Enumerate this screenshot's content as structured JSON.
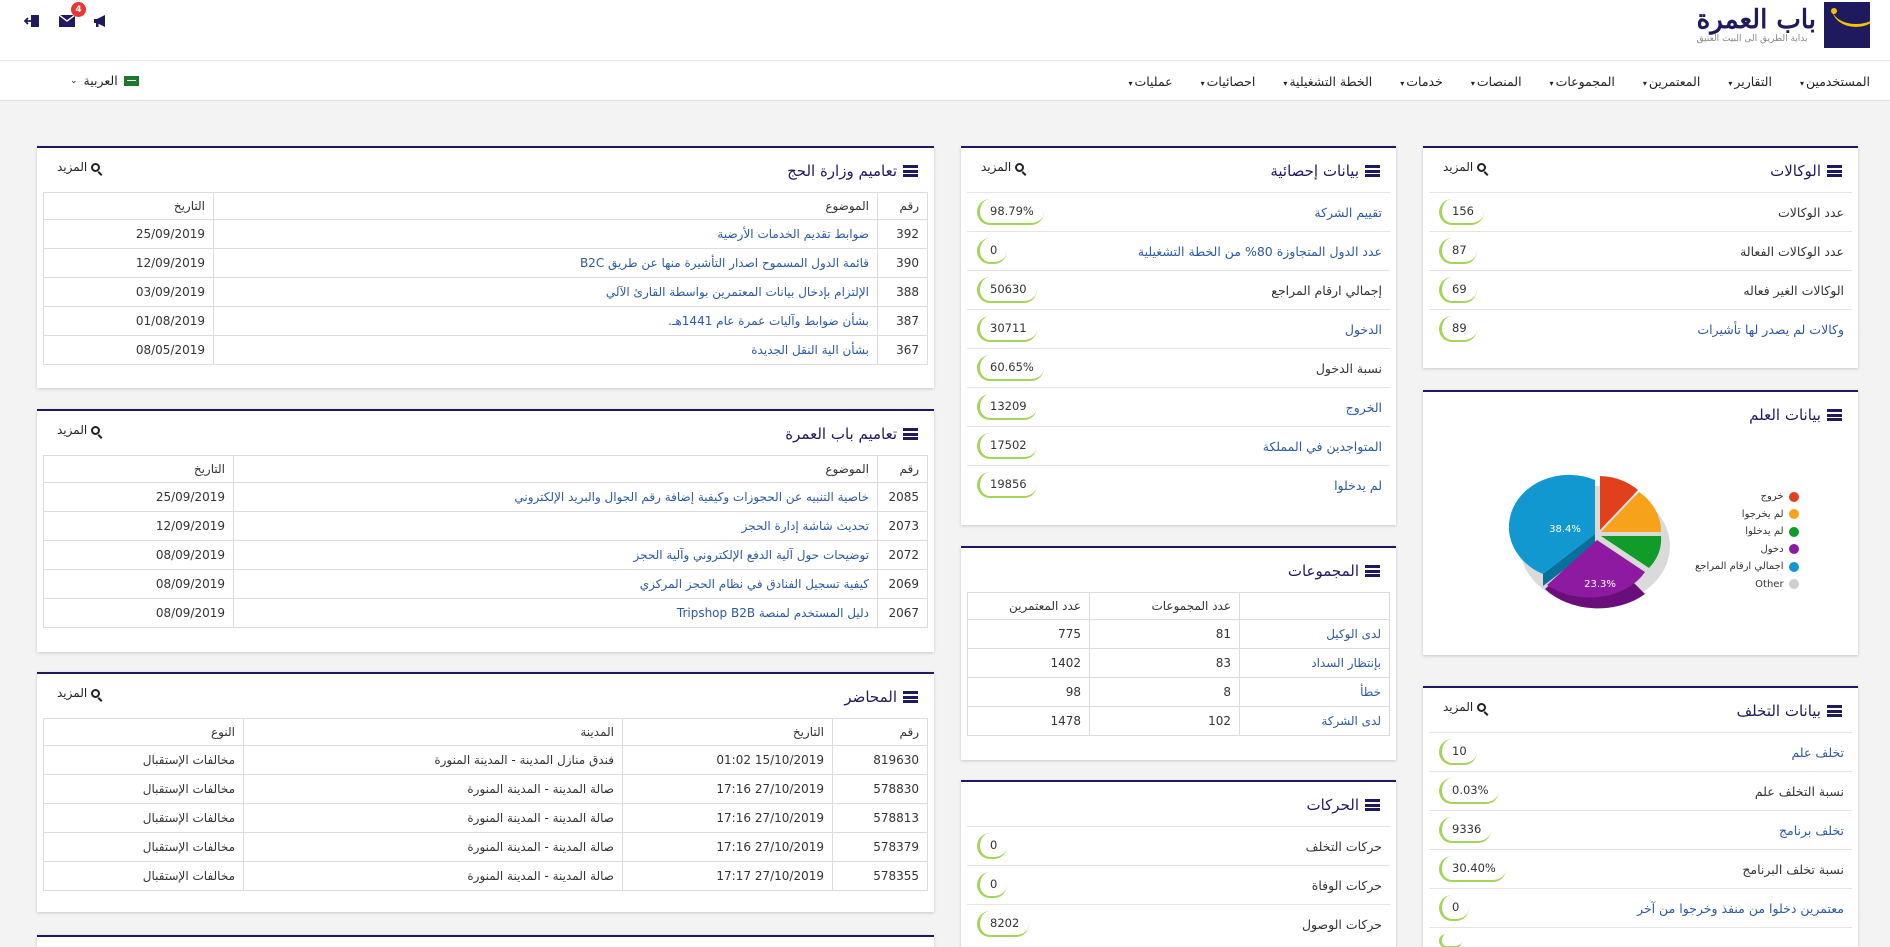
{
  "header": {
    "logo_title": "باب العمرة",
    "logo_sub": "بداية الطريق الى البيت العتيق",
    "mail_count": "4",
    "language": "العربية"
  },
  "nav": [
    "المستخدمين",
    "التقارير",
    "المعتمرين",
    "المجموعات",
    "المنصات",
    "خدمات",
    "الخطة التشغيلية",
    "احصائيات",
    "عمليات"
  ],
  "more_label": "المزيد",
  "agencies": {
    "title": "الوكالات",
    "rows": [
      {
        "label": "عدد الوكالات",
        "value": "156",
        "link": false
      },
      {
        "label": "عدد الوكالات الفعالة",
        "value": "87",
        "link": false
      },
      {
        "label": "الوكالات الغير فعاله",
        "value": "69",
        "link": false
      },
      {
        "label": "وكالات لم يصدر لها تأشيرات",
        "value": "89",
        "link": true
      }
    ]
  },
  "flag_data": {
    "title": "بيانات العلم",
    "legend": [
      {
        "label": "خروج",
        "color": "#e0401c"
      },
      {
        "label": "لم يخرجوا",
        "color": "#f7a21b"
      },
      {
        "label": "لم يدخلوا",
        "color": "#119b28"
      },
      {
        "label": "دخول",
        "color": "#8e1aa1"
      },
      {
        "label": "اجمالي ارقام المراجع",
        "color": "#1298d1"
      },
      {
        "label": "Other",
        "color": "#cfcfcf"
      }
    ],
    "slice_labels": [
      "38.4%",
      "23.3%"
    ]
  },
  "absconding": {
    "title": "بيانات التخلف",
    "rows": [
      {
        "label": "تخلف علم",
        "value": "10",
        "link": true
      },
      {
        "label": "نسبة التخلف علم",
        "value": "0.03%",
        "link": false
      },
      {
        "label": "تخلف برنامج",
        "value": "9336",
        "link": true
      },
      {
        "label": "نسبة تخلف البرنامج",
        "value": "30.40%",
        "link": false
      },
      {
        "label": "معتمرين دخلوا من منفذ وخرجوا من آخر",
        "value": "0",
        "link": true
      },
      {
        "label": "",
        "value": "",
        "link": false
      }
    ]
  },
  "stats": {
    "title": "بيانات إحصائية",
    "rows": [
      {
        "label": "تقييم الشركة",
        "value": "98.79%",
        "link": true
      },
      {
        "label": "عدد الدول المتجاوزة 80% من الخطة التشغيلية",
        "value": "0",
        "link": true
      },
      {
        "label": "إجمالي ارقام المراجع",
        "value": "50630",
        "link": false
      },
      {
        "label": "الدخول",
        "value": "30711",
        "link": true
      },
      {
        "label": "نسبة الدخول",
        "value": "60.65%",
        "link": false
      },
      {
        "label": "الخروج",
        "value": "13209",
        "link": true
      },
      {
        "label": "المتواجدين في المملكة",
        "value": "17502",
        "link": true
      },
      {
        "label": "لم يدخلوا",
        "value": "19856",
        "link": true
      }
    ]
  },
  "groups": {
    "title": "المجموعات",
    "headers": [
      "",
      "عدد المجموعات",
      "عدد المعتمرين"
    ],
    "rows": [
      [
        "لدى الوكيل",
        "81",
        "775"
      ],
      [
        "بإنتظار السداد",
        "83",
        "1402"
      ],
      [
        "خطأ",
        "8",
        "98"
      ],
      [
        "لدى الشركة",
        "102",
        "1478"
      ]
    ]
  },
  "movements": {
    "title": "الحركات",
    "rows": [
      {
        "label": "حركات التخلف",
        "value": "0"
      },
      {
        "label": "حركات الوفاة",
        "value": "0"
      },
      {
        "label": "حركات الوصول",
        "value": "8202"
      }
    ]
  },
  "ministry": {
    "title": "تعاميم وزارة الحج",
    "headers": [
      "رقم",
      "الموضوع",
      "التاريخ"
    ],
    "rows": [
      [
        "392",
        "ضوابط تقديم الخدمات الأرضية",
        "25/09/2019"
      ],
      [
        "390",
        "قائمة الدول المسموح اصدار التأشيرة منها عن طريق B2C",
        "12/09/2019"
      ],
      [
        "388",
        "الإلتزام بإدخال بيانات المعتمرين بواسطة القارئ الآلي",
        "03/09/2019"
      ],
      [
        "387",
        "بشأن ضوابط وآليات عمرة عام 1441هـ.",
        "01/08/2019"
      ],
      [
        "367",
        "بشأن الية النقل الجديدة",
        "08/05/2019"
      ]
    ]
  },
  "babumrah": {
    "title": "تعاميم باب العمرة",
    "headers": [
      "رقم",
      "الموضوع",
      "التاريخ"
    ],
    "rows": [
      [
        "2085",
        "خاصية التنبيه عن الحجوزات وكيفية إضافة رقم الجوال والبريد الإلكتروني",
        "25/09/2019"
      ],
      [
        "2073",
        "تحديث شاشة إدارة الحجز",
        "12/09/2019"
      ],
      [
        "2072",
        "توضيحات حول آلية الدفع الإلكتروني وآلية الحجز",
        "08/09/2019"
      ],
      [
        "2069",
        "كيفية تسجيل الفنادق في نظام الحجز المركزي",
        "08/09/2019"
      ],
      [
        "2067",
        "دليل المستخدم لمنصة Tripshop B2B",
        "08/09/2019"
      ]
    ]
  },
  "reports": {
    "title": "المحاضر",
    "headers": [
      "رقم",
      "التاريخ",
      "المدينة",
      "النوع"
    ],
    "rows": [
      [
        "819630",
        "15/10/2019 01:02",
        "فندق منازل المدينة - المدينة المنورة",
        "مخالفات الإستقبال"
      ],
      [
        "578830",
        "27/10/2019 17:16",
        "صالة المدينة - المدينة المنورة",
        "مخالفات الإستقبال"
      ],
      [
        "578813",
        "27/10/2019 17:16",
        "صالة المدينة - المدينة المنورة",
        "مخالفات الإستقبال"
      ],
      [
        "578379",
        "27/10/2019 17:16",
        "صالة المدينة - المدينة المنورة",
        "مخالفات الإستقبال"
      ],
      [
        "578355",
        "27/10/2019 17:17",
        "صالة المدينة - المدينة المنورة",
        "مخالفات الإستقبال"
      ]
    ]
  }
}
